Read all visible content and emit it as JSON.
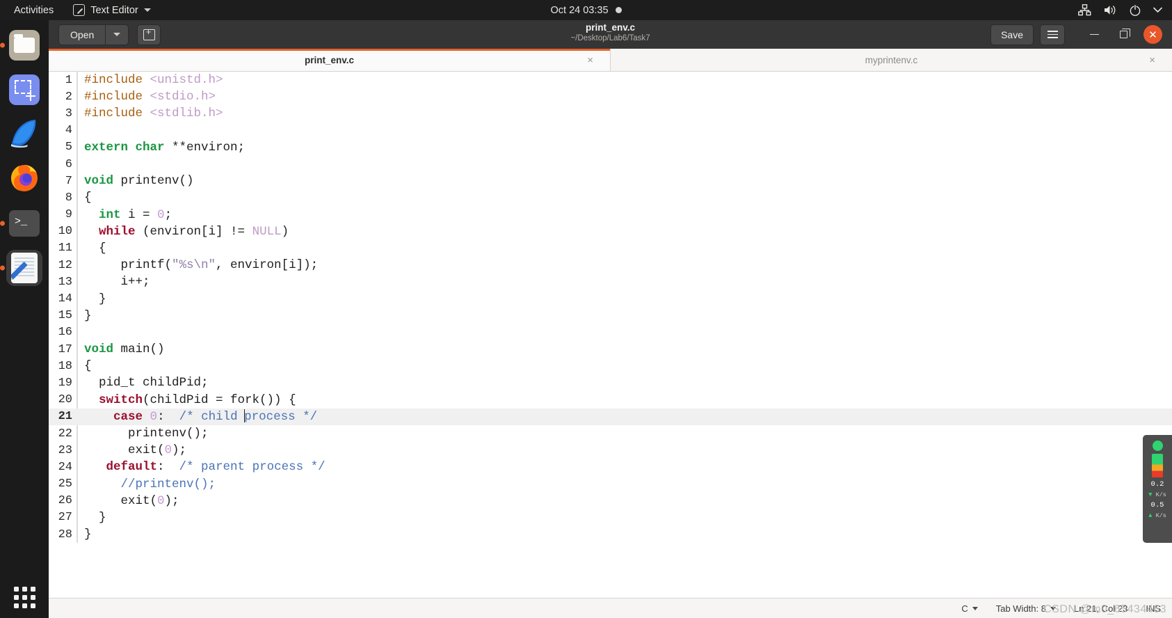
{
  "topbar": {
    "activities": "Activities",
    "app_menu": "Text Editor",
    "app_icon": "text-editor-icon",
    "clock": "Oct 24  03:35",
    "indicators": [
      "network-icon",
      "volume-icon",
      "power-icon",
      "chevron-down-icon"
    ]
  },
  "dock": {
    "items": [
      {
        "name": "files",
        "icon": "files-icon",
        "running": true
      },
      {
        "name": "screenshot",
        "icon": "screenshot-icon",
        "running": false
      },
      {
        "name": "wireshark",
        "icon": "wireshark-icon",
        "running": false
      },
      {
        "name": "firefox",
        "icon": "firefox-icon",
        "running": false
      },
      {
        "name": "terminal",
        "icon": "terminal-icon",
        "running": true
      },
      {
        "name": "text-editor",
        "icon": "text-editor-icon",
        "running": true,
        "active": true
      }
    ],
    "show_apps": "show-applications-icon"
  },
  "window": {
    "title": "print_env.c",
    "subtitle": "~/Desktop/Lab6/Task7",
    "open_label": "Open",
    "save_label": "Save",
    "new_tab_icon": "new-tab-icon",
    "menu_icon": "hamburger-menu-icon",
    "minimize_icon": "minimize-icon",
    "maximize_icon": "maximize-icon",
    "close_icon": "close-icon"
  },
  "tabs": [
    {
      "label": "print_env.c",
      "active": true,
      "close": "×"
    },
    {
      "label": "myprintenv.c",
      "active": false,
      "close": "×"
    }
  ],
  "editor": {
    "current_line": 21,
    "lines": [
      {
        "n": "1",
        "tokens": [
          {
            "t": "#include ",
            "c": "tok-pp"
          },
          {
            "t": "<unistd.h>",
            "c": "tok-hdr"
          }
        ]
      },
      {
        "n": "2",
        "tokens": [
          {
            "t": "#include ",
            "c": "tok-pp"
          },
          {
            "t": "<stdio.h>",
            "c": "tok-hdr"
          }
        ]
      },
      {
        "n": "3",
        "tokens": [
          {
            "t": "#include ",
            "c": "tok-pp"
          },
          {
            "t": "<stdlib.h>",
            "c": "tok-hdr"
          }
        ]
      },
      {
        "n": "4",
        "tokens": []
      },
      {
        "n": "5",
        "tokens": [
          {
            "t": "extern char",
            "c": "tok-kw"
          },
          {
            "t": " **environ;",
            "c": ""
          }
        ]
      },
      {
        "n": "6",
        "tokens": []
      },
      {
        "n": "7",
        "tokens": [
          {
            "t": "void",
            "c": "tok-kw"
          },
          {
            "t": " printenv()",
            "c": ""
          }
        ]
      },
      {
        "n": "8",
        "tokens": [
          {
            "t": "{",
            "c": ""
          }
        ]
      },
      {
        "n": "9",
        "tokens": [
          {
            "t": "  ",
            "c": ""
          },
          {
            "t": "int",
            "c": "tok-kw"
          },
          {
            "t": " i = ",
            "c": ""
          },
          {
            "t": "0",
            "c": "tok-num"
          },
          {
            "t": ";",
            "c": ""
          }
        ]
      },
      {
        "n": "10",
        "tokens": [
          {
            "t": "  ",
            "c": ""
          },
          {
            "t": "while",
            "c": "tok-kw2"
          },
          {
            "t": " (environ[i] != ",
            "c": ""
          },
          {
            "t": "NULL",
            "c": "tok-null"
          },
          {
            "t": ")",
            "c": ""
          }
        ]
      },
      {
        "n": "11",
        "tokens": [
          {
            "t": "  {",
            "c": ""
          }
        ]
      },
      {
        "n": "12",
        "tokens": [
          {
            "t": "     printf(",
            "c": ""
          },
          {
            "t": "\"%s\\n\"",
            "c": "tok-str"
          },
          {
            "t": ", environ[i]);",
            "c": ""
          }
        ]
      },
      {
        "n": "13",
        "tokens": [
          {
            "t": "     i++;",
            "c": ""
          }
        ]
      },
      {
        "n": "14",
        "tokens": [
          {
            "t": "  }",
            "c": ""
          }
        ]
      },
      {
        "n": "15",
        "tokens": [
          {
            "t": "}",
            "c": ""
          }
        ]
      },
      {
        "n": "16",
        "tokens": []
      },
      {
        "n": "17",
        "tokens": [
          {
            "t": "void",
            "c": "tok-kw"
          },
          {
            "t": " main()",
            "c": ""
          }
        ]
      },
      {
        "n": "18",
        "tokens": [
          {
            "t": "{",
            "c": ""
          }
        ]
      },
      {
        "n": "19",
        "tokens": [
          {
            "t": "  pid_t childPid;",
            "c": ""
          }
        ]
      },
      {
        "n": "20",
        "tokens": [
          {
            "t": "  ",
            "c": ""
          },
          {
            "t": "switch",
            "c": "tok-kw2"
          },
          {
            "t": "(childPid = fork()) {",
            "c": ""
          }
        ]
      },
      {
        "n": "21",
        "tokens": [
          {
            "t": "    ",
            "c": ""
          },
          {
            "t": "case",
            "c": "tok-kw2"
          },
          {
            "t": " ",
            "c": ""
          },
          {
            "t": "0",
            "c": "tok-num"
          },
          {
            "t": ":  ",
            "c": ""
          },
          {
            "t": "/* child ",
            "c": "tok-cmt"
          },
          {
            "t": "|CARET|",
            "c": "caret"
          },
          {
            "t": "process */",
            "c": "tok-cmt"
          }
        ]
      },
      {
        "n": "22",
        "tokens": [
          {
            "t": "      printenv();",
            "c": ""
          }
        ]
      },
      {
        "n": "23",
        "tokens": [
          {
            "t": "      exit(",
            "c": ""
          },
          {
            "t": "0",
            "c": "tok-num"
          },
          {
            "t": ");",
            "c": ""
          }
        ]
      },
      {
        "n": "24",
        "tokens": [
          {
            "t": "   ",
            "c": ""
          },
          {
            "t": "default",
            "c": "tok-kw2"
          },
          {
            "t": ":  ",
            "c": ""
          },
          {
            "t": "/* parent process */",
            "c": "tok-cmt"
          }
        ]
      },
      {
        "n": "25",
        "tokens": [
          {
            "t": "     ",
            "c": ""
          },
          {
            "t": "//printenv();",
            "c": "tok-cmt"
          }
        ]
      },
      {
        "n": "26",
        "tokens": [
          {
            "t": "     exit(",
            "c": ""
          },
          {
            "t": "0",
            "c": "tok-num"
          },
          {
            "t": ");",
            "c": ""
          }
        ]
      },
      {
        "n": "27",
        "tokens": [
          {
            "t": "  }",
            "c": ""
          }
        ]
      },
      {
        "n": "28",
        "tokens": [
          {
            "t": "}",
            "c": ""
          }
        ]
      }
    ]
  },
  "net_widget": {
    "down_value": "0.2",
    "down_unit": "K/s",
    "up_value": "0.5",
    "up_unit": "K/s"
  },
  "statusbar": {
    "language": "C",
    "tab_width": "Tab Width: 8",
    "position": "Ln 21, Col 23",
    "insert_mode": "INS",
    "watermark": "CSDN @m0_65434463"
  },
  "colors": {
    "accent": "#e8622a",
    "topbar_bg": "#1d1d1d",
    "headerbar_bg": "#353535",
    "editor_bg": "#ffffff",
    "current_line_bg": "#f0f0f0"
  }
}
